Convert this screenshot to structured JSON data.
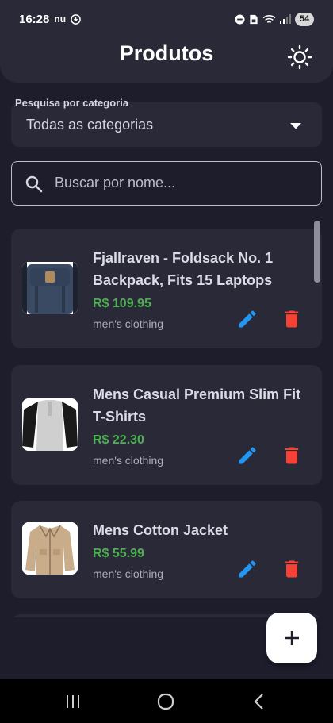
{
  "status_bar": {
    "time": "16:28",
    "carrier": "nu",
    "battery": "54"
  },
  "header": {
    "title": "Produtos"
  },
  "filter": {
    "label": "Pesquisa por categoria",
    "selected": "Todas as categorias"
  },
  "search": {
    "placeholder": "Buscar por nome..."
  },
  "products": [
    {
      "title": "Fjallraven - Foldsack No. 1 Backpack, Fits 15 Laptops",
      "price": "R$ 109.95",
      "category": "men's clothing"
    },
    {
      "title": "Mens Casual Premium Slim Fit T-Shirts",
      "price": "R$ 22.30",
      "category": "men's clothing"
    },
    {
      "title": "Mens Cotton Jacket",
      "price": "R$ 55.99",
      "category": "men's clothing"
    }
  ],
  "colors": {
    "background": "#1e1d2b",
    "card": "#2a2938",
    "price": "#4caf50",
    "edit": "#2196f3",
    "delete": "#f44336"
  },
  "icons": {
    "theme": "sun-icon",
    "dropdown": "caret-down-icon",
    "search": "search-icon",
    "edit": "pencil-icon",
    "delete": "trash-icon",
    "fab": "plus-icon"
  }
}
